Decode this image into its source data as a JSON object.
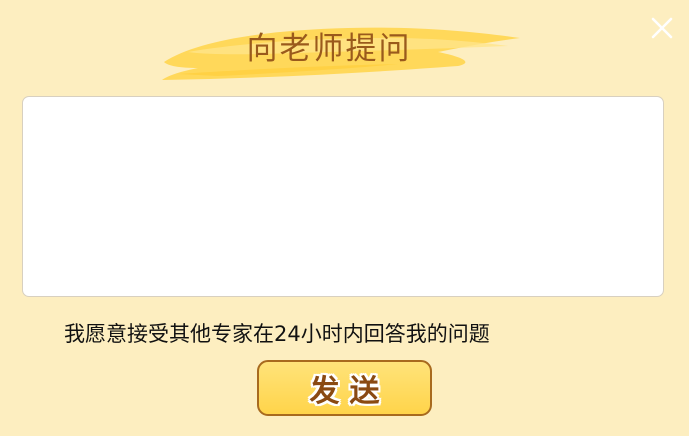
{
  "dialog": {
    "title": "向老师提问",
    "close_icon": "close-icon",
    "question_input": {
      "value": "",
      "placeholder": ""
    },
    "agree_text": "我愿意接受其他专家在24小时内回答我的问题",
    "send_label": "发送",
    "colors": {
      "background": "#fdeec0",
      "title_text": "#9a5a1c",
      "brush": "#ffd85a",
      "button_fill": "#ffd44a",
      "button_border": "#a86a1e",
      "button_text": "#8a4a12"
    }
  }
}
